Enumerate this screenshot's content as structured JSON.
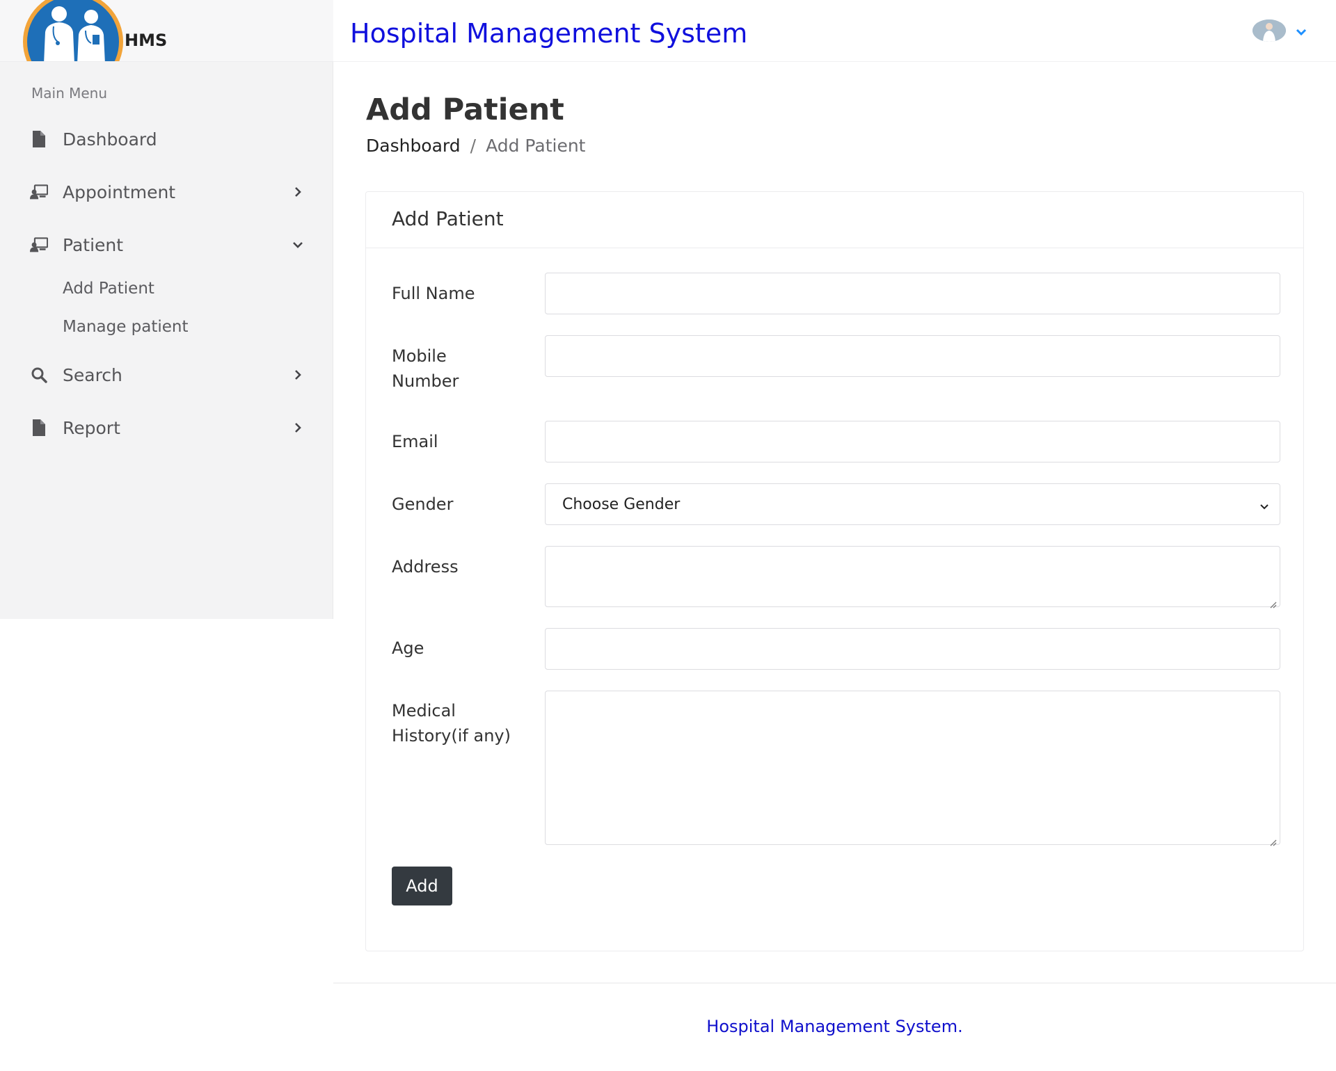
{
  "brand": {
    "short_name": "HMS"
  },
  "header": {
    "title": "Hospital Management System"
  },
  "sidebar": {
    "heading": "Main Menu",
    "items": [
      {
        "label": "Dashboard",
        "icon": "document-icon",
        "has_children": false
      },
      {
        "label": "Appointment",
        "icon": "user-board-icon",
        "has_children": true,
        "expanded": false
      },
      {
        "label": "Patient",
        "icon": "user-board-icon",
        "has_children": true,
        "expanded": true,
        "children": [
          "Add Patient",
          "Manage patient"
        ]
      },
      {
        "label": "Search",
        "icon": "search-icon",
        "has_children": true,
        "expanded": false
      },
      {
        "label": "Report",
        "icon": "document-icon",
        "has_children": true,
        "expanded": false
      }
    ]
  },
  "page": {
    "title": "Add Patient",
    "breadcrumb": {
      "parent": "Dashboard",
      "separator": "/",
      "current": "Add Patient"
    }
  },
  "form": {
    "card_title": "Add Patient",
    "fields": {
      "full_name": {
        "label": "Full Name",
        "value": ""
      },
      "mobile": {
        "label_line1": "Mobile",
        "label_line2": "Number",
        "value": ""
      },
      "email": {
        "label": "Email",
        "value": ""
      },
      "gender": {
        "label": "Gender",
        "selected": "Choose Gender"
      },
      "address": {
        "label": "Address",
        "value": ""
      },
      "age": {
        "label": "Age",
        "value": ""
      },
      "medical_history": {
        "label_line1": "Medical",
        "label_line2": "History(if any)",
        "value": ""
      }
    },
    "submit_label": "Add"
  },
  "footer": {
    "text": "Hospital Management System."
  },
  "colors": {
    "header_title": "#1010dd",
    "accent_chevron": "#1e90ff",
    "logo_blue": "#1e6fb8",
    "logo_ring": "#f2a43a",
    "button_dark": "#343a40",
    "sidebar_bg": "#f3f3f4"
  }
}
